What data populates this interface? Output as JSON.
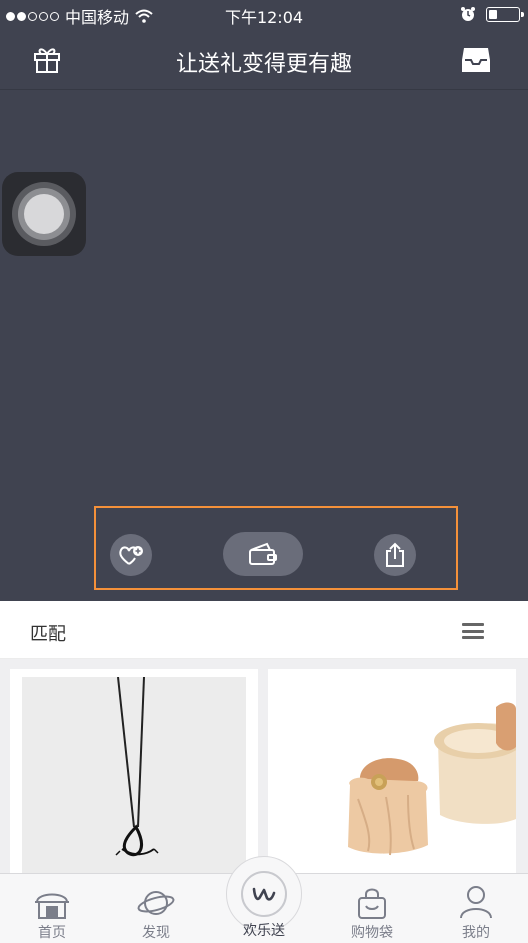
{
  "status_bar": {
    "carrier": "中国移动",
    "time": "下午12:04",
    "signal_dots_filled": 2,
    "signal_dots_total": 5
  },
  "navbar": {
    "title": "让送礼变得更有趣",
    "left_icon": "gift-icon",
    "right_icon": "inbox-icon"
  },
  "actions": [
    {
      "icon": "heart-plus-icon",
      "name": "favorite"
    },
    {
      "icon": "wallet-icon",
      "name": "wallet"
    },
    {
      "icon": "share-icon",
      "name": "share"
    }
  ],
  "filter": {
    "label": "匹配",
    "menu_icon": "menu-icon"
  },
  "products": [
    {
      "image": "necklace-image"
    },
    {
      "image": "leather-pouch-image"
    }
  ],
  "tabs": [
    {
      "label": "首页",
      "icon": "home-icon"
    },
    {
      "label": "发现",
      "icon": "planet-icon"
    },
    {
      "label": "欢乐送",
      "icon": "w-logo-icon"
    },
    {
      "label": "购物袋",
      "icon": "bag-icon"
    },
    {
      "label": "我的",
      "icon": "user-icon"
    }
  ],
  "colors": {
    "dark_background": "#404350",
    "highlight_border": "#f5913a",
    "tab_label": "#7b7e8a"
  }
}
